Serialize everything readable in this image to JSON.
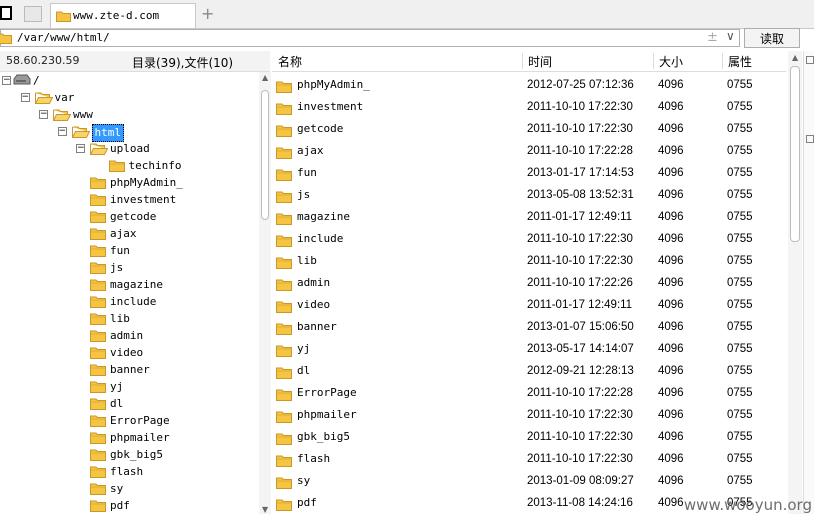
{
  "tab": {
    "title": "www.zte-d.com",
    "new_tab_symbol": "+"
  },
  "address": {
    "path": "/var/www/html/",
    "read_button": "读取"
  },
  "left_pane": {
    "ip": "58.60.230.59",
    "count_label": "目录(39),文件(10)",
    "tree": [
      {
        "label": "/",
        "icon": "drive-icon",
        "toggle": "−",
        "depth": 0
      },
      {
        "label": "var",
        "icon": "folder-icon",
        "toggle": "−",
        "depth": 1
      },
      {
        "label": "www",
        "icon": "folder-icon",
        "toggle": "−",
        "depth": 2
      },
      {
        "label": "html",
        "icon": "folder-icon",
        "toggle": "−",
        "depth": 3,
        "selected": true
      },
      {
        "label": "upload",
        "icon": "folder-icon",
        "toggle": "−",
        "depth": 4
      },
      {
        "label": "techinfo",
        "icon": "folder-icon",
        "toggle": "",
        "depth": 5
      },
      {
        "label": "phpMyAdmin_",
        "icon": "folder-icon",
        "toggle": "",
        "depth": 4
      },
      {
        "label": "investment",
        "icon": "folder-icon",
        "toggle": "",
        "depth": 4
      },
      {
        "label": "getcode",
        "icon": "folder-icon",
        "toggle": "",
        "depth": 4
      },
      {
        "label": "ajax",
        "icon": "folder-icon",
        "toggle": "",
        "depth": 4
      },
      {
        "label": "fun",
        "icon": "folder-icon",
        "toggle": "",
        "depth": 4
      },
      {
        "label": "js",
        "icon": "folder-icon",
        "toggle": "",
        "depth": 4
      },
      {
        "label": "magazine",
        "icon": "folder-icon",
        "toggle": "",
        "depth": 4
      },
      {
        "label": "include",
        "icon": "folder-icon",
        "toggle": "",
        "depth": 4
      },
      {
        "label": "lib",
        "icon": "folder-icon",
        "toggle": "",
        "depth": 4
      },
      {
        "label": "admin",
        "icon": "folder-icon",
        "toggle": "",
        "depth": 4
      },
      {
        "label": "video",
        "icon": "folder-icon",
        "toggle": "",
        "depth": 4
      },
      {
        "label": "banner",
        "icon": "folder-icon",
        "toggle": "",
        "depth": 4
      },
      {
        "label": "yj",
        "icon": "folder-icon",
        "toggle": "",
        "depth": 4
      },
      {
        "label": "dl",
        "icon": "folder-icon",
        "toggle": "",
        "depth": 4
      },
      {
        "label": "ErrorPage",
        "icon": "folder-icon",
        "toggle": "",
        "depth": 4
      },
      {
        "label": "phpmailer",
        "icon": "folder-icon",
        "toggle": "",
        "depth": 4
      },
      {
        "label": "gbk_big5",
        "icon": "folder-icon",
        "toggle": "",
        "depth": 4
      },
      {
        "label": "flash",
        "icon": "folder-icon",
        "toggle": "",
        "depth": 4
      },
      {
        "label": "sy",
        "icon": "folder-icon",
        "toggle": "",
        "depth": 4
      },
      {
        "label": "pdf",
        "icon": "folder-icon",
        "toggle": "",
        "depth": 4
      }
    ]
  },
  "file_list": {
    "columns": {
      "name": "名称",
      "time": "时间",
      "size": "大小",
      "perm": "属性"
    },
    "rows": [
      {
        "name": "phpMyAdmin_",
        "time": "2012-07-25 07:12:36",
        "size": "4096",
        "perm": "0755"
      },
      {
        "name": "investment",
        "time": "2011-10-10 17:22:30",
        "size": "4096",
        "perm": "0755"
      },
      {
        "name": "getcode",
        "time": "2011-10-10 17:22:30",
        "size": "4096",
        "perm": "0755"
      },
      {
        "name": "ajax",
        "time": "2011-10-10 17:22:28",
        "size": "4096",
        "perm": "0755"
      },
      {
        "name": "fun",
        "time": "2013-01-17 17:14:53",
        "size": "4096",
        "perm": "0755"
      },
      {
        "name": "js",
        "time": "2013-05-08 13:52:31",
        "size": "4096",
        "perm": "0755"
      },
      {
        "name": "magazine",
        "time": "2011-01-17 12:49:11",
        "size": "4096",
        "perm": "0755"
      },
      {
        "name": "include",
        "time": "2011-10-10 17:22:30",
        "size": "4096",
        "perm": "0755"
      },
      {
        "name": "lib",
        "time": "2011-10-10 17:22:30",
        "size": "4096",
        "perm": "0755"
      },
      {
        "name": "admin",
        "time": "2011-10-10 17:22:26",
        "size": "4096",
        "perm": "0755"
      },
      {
        "name": "video",
        "time": "2011-01-17 12:49:11",
        "size": "4096",
        "perm": "0755"
      },
      {
        "name": "banner",
        "time": "2013-01-07 15:06:50",
        "size": "4096",
        "perm": "0755"
      },
      {
        "name": "yj",
        "time": "2013-05-17 14:14:07",
        "size": "4096",
        "perm": "0755"
      },
      {
        "name": "dl",
        "time": "2012-09-21 12:28:13",
        "size": "4096",
        "perm": "0755"
      },
      {
        "name": "ErrorPage",
        "time": "2011-10-10 17:22:28",
        "size": "4096",
        "perm": "0755"
      },
      {
        "name": "phpmailer",
        "time": "2011-10-10 17:22:30",
        "size": "4096",
        "perm": "0755"
      },
      {
        "name": "gbk_big5",
        "time": "2011-10-10 17:22:30",
        "size": "4096",
        "perm": "0755"
      },
      {
        "name": "flash",
        "time": "2011-10-10 17:22:30",
        "size": "4096",
        "perm": "0755"
      },
      {
        "name": "sy",
        "time": "2013-01-09 08:09:27",
        "size": "4096",
        "perm": "0755"
      },
      {
        "name": "pdf",
        "time": "2013-11-08 14:24:16",
        "size": "4096",
        "perm": "0755"
      }
    ]
  },
  "watermark": "www.wooyun.org",
  "colors": {
    "folder": "#f5c542",
    "folder_edge": "#c9972a",
    "selection": "#3399ff"
  }
}
